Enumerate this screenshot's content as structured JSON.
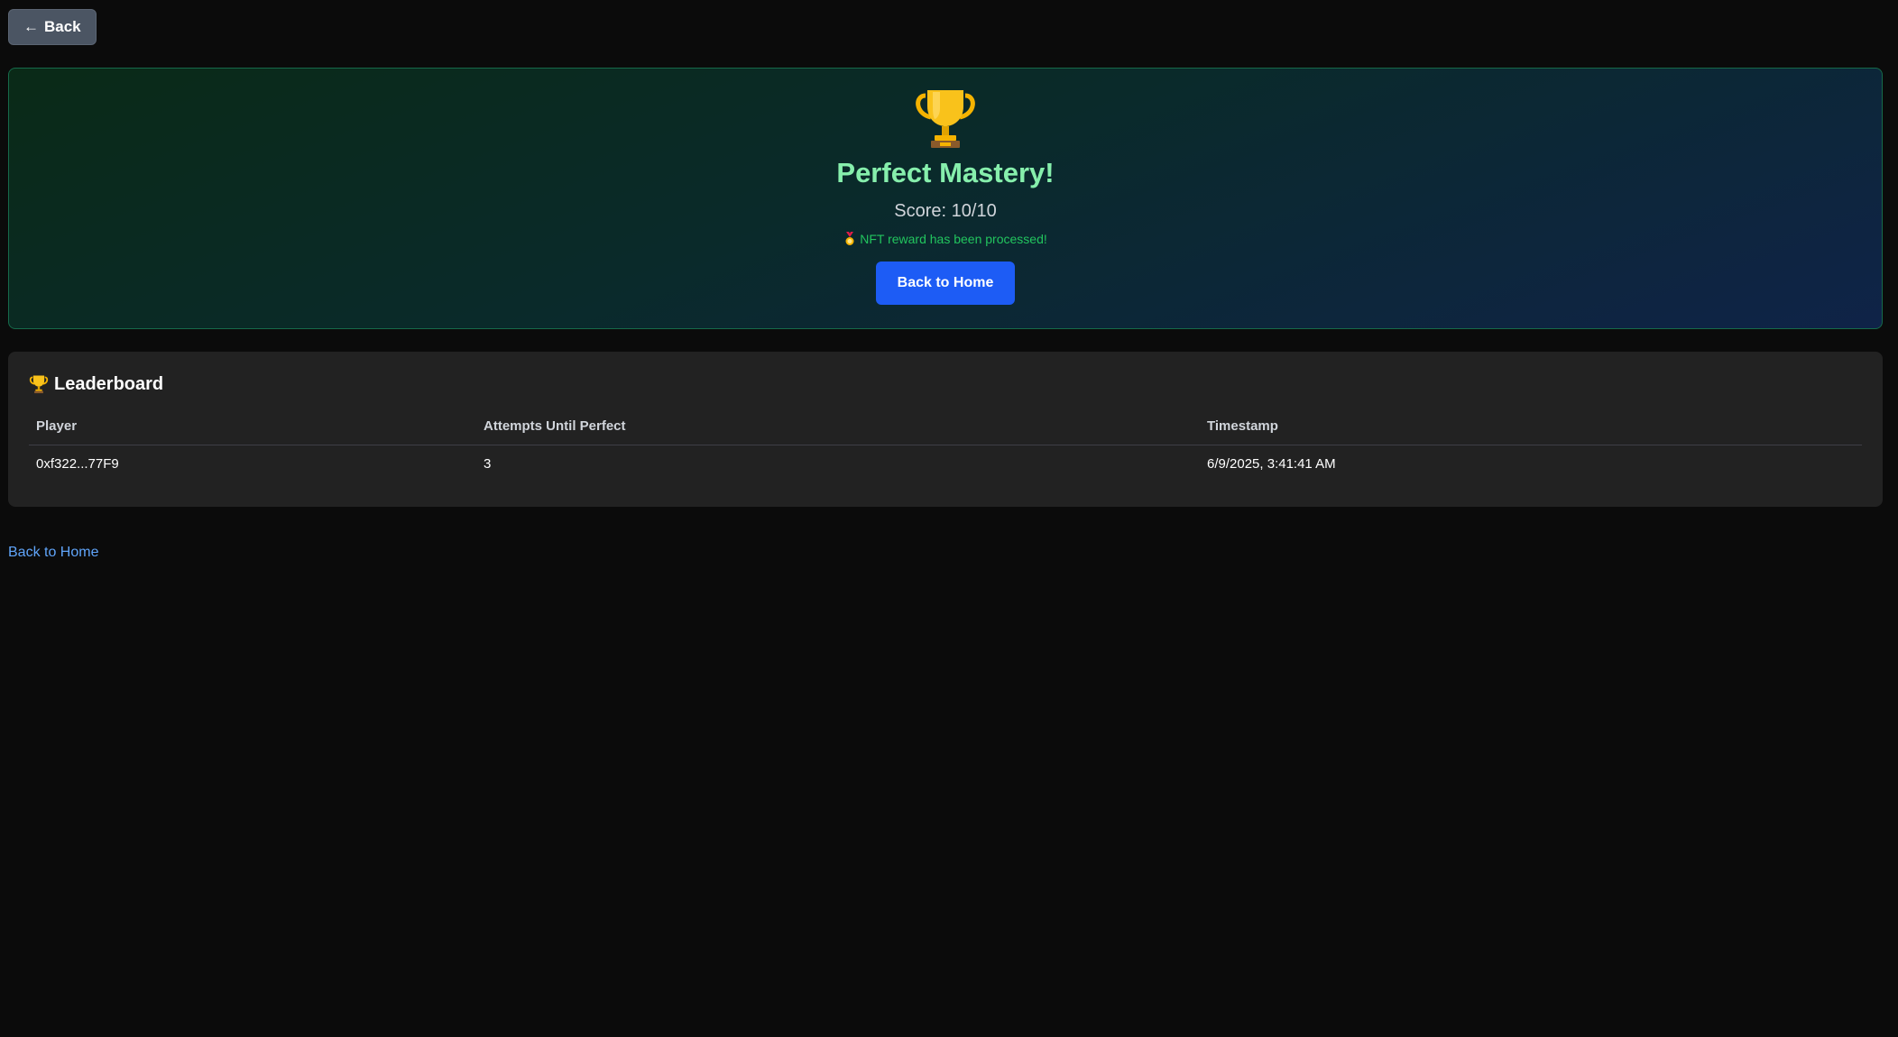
{
  "nav": {
    "back_label": "Back",
    "back_arrow": "←"
  },
  "result": {
    "trophy_icon": "trophy-icon",
    "title": "Perfect Mastery!",
    "score_text": "Score: 10/10",
    "nft_message": "NFT reward has been processed!",
    "nft_icon": "medal-icon",
    "home_button_label": "Back to Home"
  },
  "leaderboard": {
    "title": "Leaderboard",
    "columns": [
      "Player",
      "Attempts Until Perfect",
      "Timestamp"
    ],
    "rows": [
      {
        "player": "0xf322...77F9",
        "attempts": "3",
        "timestamp": "6/9/2025, 3:41:41 AM"
      }
    ]
  },
  "footer": {
    "home_link_label": "Back to Home"
  },
  "colors": {
    "background": "#0b0b0b",
    "success_green": "#86efac",
    "nft_green": "#22c55e",
    "primary_blue": "#1d5cf5",
    "link_blue": "#60a5fa",
    "panel": "#222222"
  }
}
